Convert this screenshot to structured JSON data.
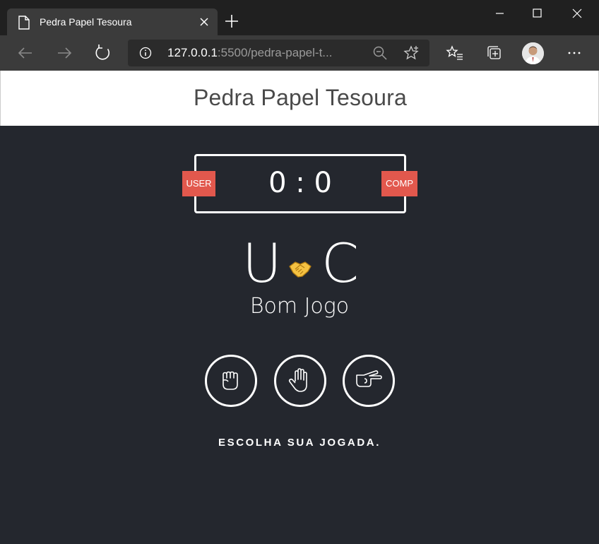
{
  "browser": {
    "tab_title": "Pedra Papel Tesoura",
    "url_host": "127.0.0.1",
    "url_rest": ":5500/pedra-papel-t...",
    "icons": [
      "document-icon",
      "close-icon",
      "new-tab-icon",
      "minimize-icon",
      "maximize-icon",
      "window-close-icon",
      "back-icon",
      "forward-icon",
      "refresh-icon",
      "info-icon",
      "zoom-icon",
      "star-icon",
      "favorites-icon",
      "collections-icon",
      "avatar",
      "more-icon"
    ]
  },
  "page": {
    "title": "Pedra Papel Tesoura",
    "badge_user": "USER",
    "badge_comp": "COMP",
    "score": "0 : 0",
    "user_letter": "U",
    "comp_letter": "C",
    "result_icon": "handshake-icon",
    "result_message": "Bom Jogo",
    "choices": [
      "rock-icon",
      "paper-icon",
      "scissors-icon"
    ],
    "instruction": "ESCOLHA SUA JOGADA.",
    "colors": {
      "background": "#24272e",
      "badge": "#e2584d",
      "header": "#ffffff"
    }
  }
}
